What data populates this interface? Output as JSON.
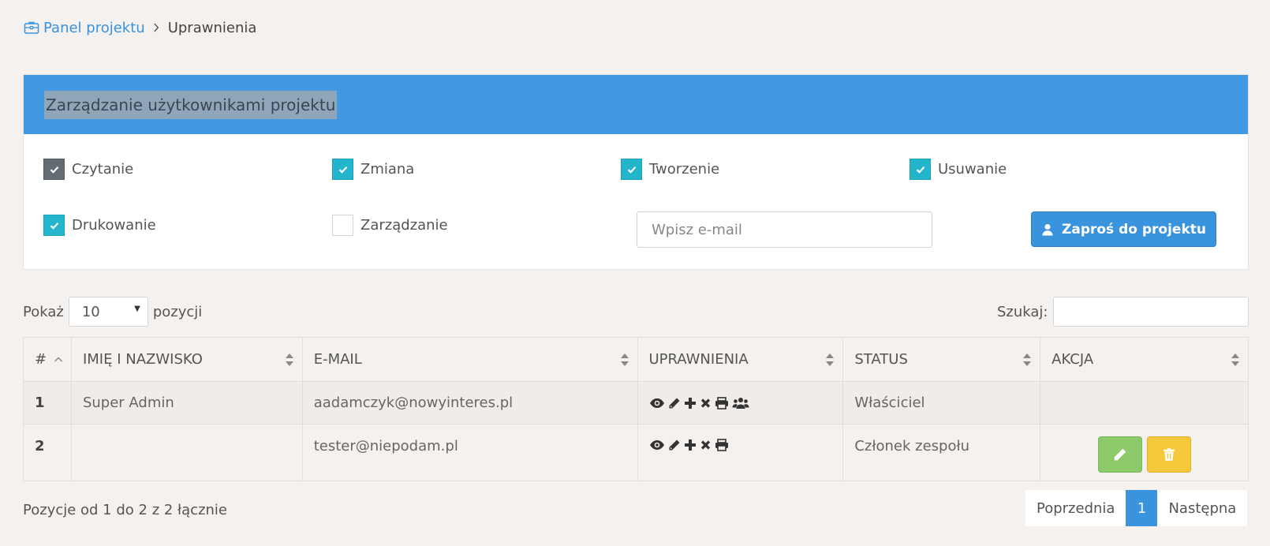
{
  "breadcrumb": {
    "home": "Panel projektu",
    "current": "Uprawnienia"
  },
  "panel": {
    "title": "Zarządzanie użytkownikami projektu",
    "permissions": [
      {
        "label": "Czytanie",
        "checked": true
      },
      {
        "label": "Zmiana",
        "checked": true
      },
      {
        "label": "Tworzenie",
        "checked": true
      },
      {
        "label": "Usuwanie",
        "checked": true
      },
      {
        "label": "Drukowanie",
        "checked": true
      },
      {
        "label": "Zarządzanie",
        "checked": false
      }
    ],
    "email_placeholder": "Wpisz e-mail",
    "invite_label": "Zaproś do projektu"
  },
  "table_controls": {
    "show_prefix": "Pokaż",
    "page_size": "10",
    "show_suffix": "pozycji",
    "search_label": "Szukaj:"
  },
  "table": {
    "headers": [
      "#",
      "IMIĘ I NAZWISKO",
      "E-MAIL",
      "UPRAWNIENIA",
      "STATUS",
      "AKCJA"
    ],
    "rows": [
      {
        "num": "1",
        "name": "Super Admin",
        "email": "aadamczyk@nowyinteres.pl",
        "permissions": [
          "eye-icon",
          "pencil-icon",
          "plus-icon",
          "times-icon",
          "print-icon",
          "users-icon"
        ],
        "status": "Właściciel"
      },
      {
        "num": "2",
        "name": "",
        "email": "tester@niepodam.pl",
        "permissions": [
          "eye-icon",
          "pencil-icon",
          "plus-icon",
          "times-icon",
          "print-icon"
        ],
        "status": "Członek zespołu"
      }
    ]
  },
  "footer": {
    "info": "Pozycje od 1 do 2 z 2 łącznie",
    "prev": "Poprzednia",
    "page": "1",
    "next": "Następna"
  },
  "colors": {
    "accent": "#3a93dd",
    "header_bar": "#4299e1",
    "checkbox": "#22b5cc",
    "edit": "#8dca69",
    "delete": "#f6c83b"
  }
}
